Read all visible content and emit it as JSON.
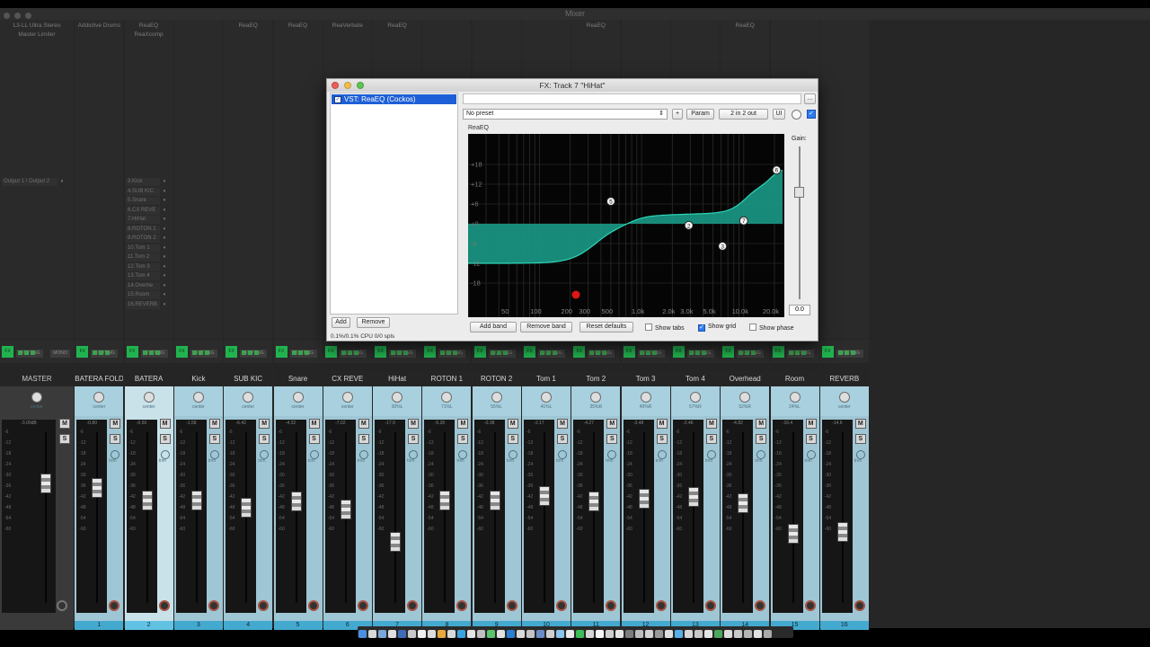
{
  "mixer": {
    "title": "Mixer",
    "master_fx": [
      "L3-LL Ultra Stereo",
      "Master Limiter"
    ],
    "track_fx": [
      {
        "index": 1,
        "items": [
          "Addictive Drums"
        ]
      },
      {
        "index": 2,
        "items": [
          "ReaEQ",
          "ReaXcomp"
        ]
      },
      {
        "index": 4,
        "items": [
          "ReaEQ"
        ]
      },
      {
        "index": 5,
        "items": [
          "ReaEQ"
        ]
      },
      {
        "index": 6,
        "items": [
          "ReaVerbate"
        ]
      },
      {
        "index": 7,
        "items": [
          "ReaEQ"
        ]
      },
      {
        "index": 11,
        "items": [
          "ReaEQ"
        ]
      },
      {
        "index": 14,
        "items": [
          "ReaEQ"
        ]
      }
    ],
    "master_output": "Output 1 / Output 2",
    "folder_sends": [
      "3.Kick",
      "4.SUB KIC",
      "5.Snare",
      "6.CX REVE",
      "7.HiHat",
      "8.ROTON 1",
      "9.ROTON 2",
      "10.Tom 1",
      "11.Tom 2",
      "12.Tom 3",
      "13.Tom 4",
      "14.Overhe",
      "15.Room",
      "16.REVERB"
    ],
    "button_labels": {
      "fx": "FX",
      "routing": "ROUTING",
      "mono": "MONO",
      "mute": "M",
      "solo": "S",
      "trim": "trim"
    },
    "strips": [
      {
        "name": "MASTER",
        "num": "",
        "pan": "center",
        "vol": "-3.00dB",
        "fader": 0.73,
        "master": true
      },
      {
        "name": "BATERA FOLD",
        "num": "1",
        "pan": "center",
        "vol": "-0.80",
        "fader": 0.7
      },
      {
        "name": "BATERA",
        "num": "2",
        "pan": "center",
        "vol": "-0.60",
        "fader": 0.62,
        "selected": true
      },
      {
        "name": "Kick",
        "num": "3",
        "pan": "center",
        "vol": "-1.58",
        "fader": 0.62
      },
      {
        "name": "SUB KIC",
        "num": "4",
        "pan": "center",
        "vol": "-6.42",
        "fader": 0.57
      },
      {
        "name": "Snare",
        "num": "5",
        "pan": "center",
        "vol": "-4.32",
        "fader": 0.61
      },
      {
        "name": "CX REVE",
        "num": "6",
        "pan": "center",
        "vol": "-7.02",
        "fader": 0.56
      },
      {
        "name": "HiHat",
        "num": "7",
        "pan": "30%L",
        "vol": "-17.9",
        "fader": 0.35
      },
      {
        "name": "ROTON 1",
        "num": "8",
        "pan": "71%L",
        "vol": "-5.28",
        "fader": 0.62
      },
      {
        "name": "ROTON 2",
        "num": "9",
        "pan": "55%L",
        "vol": "-0.38",
        "fader": 0.62
      },
      {
        "name": "Tom 1",
        "num": "10",
        "pan": "41%L",
        "vol": "-2.17",
        "fader": 0.65
      },
      {
        "name": "Tom 2",
        "num": "11",
        "pan": "35%R",
        "vol": "-4.27",
        "fader": 0.61
      },
      {
        "name": "Tom 3",
        "num": "12",
        "pan": "49%R",
        "vol": "-3.48",
        "fader": 0.63
      },
      {
        "name": "Tom 4",
        "num": "13",
        "pan": "57%R",
        "vol": "-2.46",
        "fader": 0.64
      },
      {
        "name": "Overhead",
        "num": "14",
        "pan": "52%R",
        "vol": "-4.82",
        "fader": 0.6
      },
      {
        "name": "Room",
        "num": "15",
        "pan": "24%L",
        "vol": "-16.4",
        "fader": 0.4
      },
      {
        "name": "REVERB",
        "num": "16",
        "pan": "center",
        "vol": "-14.6",
        "fader": 0.41
      }
    ]
  },
  "fx_window": {
    "title": "FX: Track 7 \"HiHat\"",
    "plugin": "VST: ReaEQ (Cockos)",
    "add_label": "Add",
    "remove_label": "Remove",
    "cpu": "0.1%/0.1% CPU 0/0 spls",
    "preset": "No preset",
    "plus_label": "+",
    "param_label": "Param",
    "io_label": "2 in 2 out",
    "ui_label": "UI",
    "more_label": "...",
    "plugin_name": "ReaEQ",
    "gain_label": "Gain:",
    "gain_value": "0.0",
    "add_band": "Add band",
    "remove_band": "Remove band",
    "reset_defaults": "Reset defaults",
    "show_tabs": "Show tabs",
    "show_grid": "Show grid",
    "show_phase": "Show phase",
    "show_tabs_checked": false,
    "show_grid_checked": true,
    "show_phase_checked": false,
    "db_labels": [
      "+18",
      "+12",
      "+6",
      "+0",
      "-6",
      "-12",
      "-18"
    ],
    "freq_labels": [
      "50",
      "100",
      "200",
      "300",
      "500",
      "1.0k",
      "2.0k",
      "3.0k",
      "5.0k",
      "10.0k",
      "20.0k"
    ],
    "band_nodes": [
      "5",
      "2",
      "3",
      "7",
      "6"
    ],
    "eq_fill_color": "#1a9683"
  }
}
